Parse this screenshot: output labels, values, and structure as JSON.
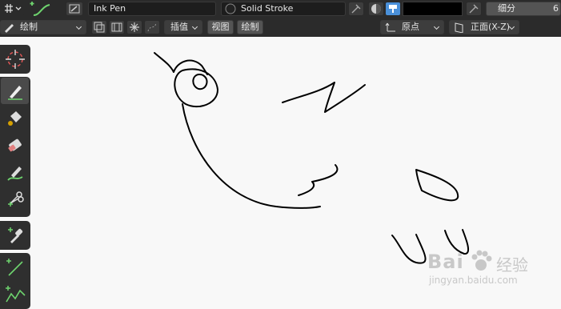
{
  "topbar": {
    "brush_name": "Ink Pen",
    "material_name": "Solid Stroke",
    "subdivide_label": "细分",
    "subdivide_value": "6",
    "vertex_color": "#000000"
  },
  "toolbar": {
    "mode_label": "绘制",
    "interpolate_label": "插值",
    "view_label": "视图",
    "draw_label": "绘制",
    "origin_label": "原点",
    "plane_label": "正面(X-Z)"
  },
  "tools": {
    "items": [
      {
        "name": "cursor-tool"
      },
      {
        "name": "draw-tool"
      },
      {
        "name": "fill-tool"
      },
      {
        "name": "erase-tool"
      },
      {
        "name": "tint-tool"
      },
      {
        "name": "cutter-tool"
      },
      {
        "name": "eyedropper-tool"
      },
      {
        "name": "line-tool"
      },
      {
        "name": "polyline-tool"
      }
    ]
  },
  "watermark": {
    "brand": "Bai",
    "brand2": "经验",
    "url": "jingyan.baidu.com"
  },
  "colors": {
    "header_bg": "#2b2b2b",
    "canvas_bg": "#f8f8f8",
    "stroke": "#000000",
    "accent_green": "#6ed46e",
    "accent_blue": "#4a90d9"
  }
}
